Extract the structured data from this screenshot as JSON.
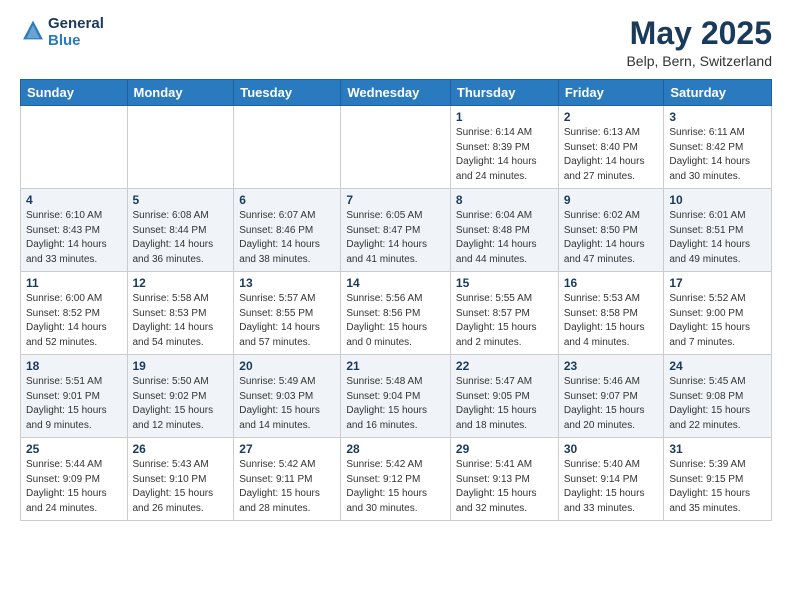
{
  "logo": {
    "line1": "General",
    "line2": "Blue"
  },
  "title": "May 2025",
  "subtitle": "Belp, Bern, Switzerland",
  "weekdays": [
    "Sunday",
    "Monday",
    "Tuesday",
    "Wednesday",
    "Thursday",
    "Friday",
    "Saturday"
  ],
  "weeks": [
    [
      {
        "day": "",
        "info": ""
      },
      {
        "day": "",
        "info": ""
      },
      {
        "day": "",
        "info": ""
      },
      {
        "day": "",
        "info": ""
      },
      {
        "day": "1",
        "info": "Sunrise: 6:14 AM\nSunset: 8:39 PM\nDaylight: 14 hours\nand 24 minutes."
      },
      {
        "day": "2",
        "info": "Sunrise: 6:13 AM\nSunset: 8:40 PM\nDaylight: 14 hours\nand 27 minutes."
      },
      {
        "day": "3",
        "info": "Sunrise: 6:11 AM\nSunset: 8:42 PM\nDaylight: 14 hours\nand 30 minutes."
      }
    ],
    [
      {
        "day": "4",
        "info": "Sunrise: 6:10 AM\nSunset: 8:43 PM\nDaylight: 14 hours\nand 33 minutes."
      },
      {
        "day": "5",
        "info": "Sunrise: 6:08 AM\nSunset: 8:44 PM\nDaylight: 14 hours\nand 36 minutes."
      },
      {
        "day": "6",
        "info": "Sunrise: 6:07 AM\nSunset: 8:46 PM\nDaylight: 14 hours\nand 38 minutes."
      },
      {
        "day": "7",
        "info": "Sunrise: 6:05 AM\nSunset: 8:47 PM\nDaylight: 14 hours\nand 41 minutes."
      },
      {
        "day": "8",
        "info": "Sunrise: 6:04 AM\nSunset: 8:48 PM\nDaylight: 14 hours\nand 44 minutes."
      },
      {
        "day": "9",
        "info": "Sunrise: 6:02 AM\nSunset: 8:50 PM\nDaylight: 14 hours\nand 47 minutes."
      },
      {
        "day": "10",
        "info": "Sunrise: 6:01 AM\nSunset: 8:51 PM\nDaylight: 14 hours\nand 49 minutes."
      }
    ],
    [
      {
        "day": "11",
        "info": "Sunrise: 6:00 AM\nSunset: 8:52 PM\nDaylight: 14 hours\nand 52 minutes."
      },
      {
        "day": "12",
        "info": "Sunrise: 5:58 AM\nSunset: 8:53 PM\nDaylight: 14 hours\nand 54 minutes."
      },
      {
        "day": "13",
        "info": "Sunrise: 5:57 AM\nSunset: 8:55 PM\nDaylight: 14 hours\nand 57 minutes."
      },
      {
        "day": "14",
        "info": "Sunrise: 5:56 AM\nSunset: 8:56 PM\nDaylight: 15 hours\nand 0 minutes."
      },
      {
        "day": "15",
        "info": "Sunrise: 5:55 AM\nSunset: 8:57 PM\nDaylight: 15 hours\nand 2 minutes."
      },
      {
        "day": "16",
        "info": "Sunrise: 5:53 AM\nSunset: 8:58 PM\nDaylight: 15 hours\nand 4 minutes."
      },
      {
        "day": "17",
        "info": "Sunrise: 5:52 AM\nSunset: 9:00 PM\nDaylight: 15 hours\nand 7 minutes."
      }
    ],
    [
      {
        "day": "18",
        "info": "Sunrise: 5:51 AM\nSunset: 9:01 PM\nDaylight: 15 hours\nand 9 minutes."
      },
      {
        "day": "19",
        "info": "Sunrise: 5:50 AM\nSunset: 9:02 PM\nDaylight: 15 hours\nand 12 minutes."
      },
      {
        "day": "20",
        "info": "Sunrise: 5:49 AM\nSunset: 9:03 PM\nDaylight: 15 hours\nand 14 minutes."
      },
      {
        "day": "21",
        "info": "Sunrise: 5:48 AM\nSunset: 9:04 PM\nDaylight: 15 hours\nand 16 minutes."
      },
      {
        "day": "22",
        "info": "Sunrise: 5:47 AM\nSunset: 9:05 PM\nDaylight: 15 hours\nand 18 minutes."
      },
      {
        "day": "23",
        "info": "Sunrise: 5:46 AM\nSunset: 9:07 PM\nDaylight: 15 hours\nand 20 minutes."
      },
      {
        "day": "24",
        "info": "Sunrise: 5:45 AM\nSunset: 9:08 PM\nDaylight: 15 hours\nand 22 minutes."
      }
    ],
    [
      {
        "day": "25",
        "info": "Sunrise: 5:44 AM\nSunset: 9:09 PM\nDaylight: 15 hours\nand 24 minutes."
      },
      {
        "day": "26",
        "info": "Sunrise: 5:43 AM\nSunset: 9:10 PM\nDaylight: 15 hours\nand 26 minutes."
      },
      {
        "day": "27",
        "info": "Sunrise: 5:42 AM\nSunset: 9:11 PM\nDaylight: 15 hours\nand 28 minutes."
      },
      {
        "day": "28",
        "info": "Sunrise: 5:42 AM\nSunset: 9:12 PM\nDaylight: 15 hours\nand 30 minutes."
      },
      {
        "day": "29",
        "info": "Sunrise: 5:41 AM\nSunset: 9:13 PM\nDaylight: 15 hours\nand 32 minutes."
      },
      {
        "day": "30",
        "info": "Sunrise: 5:40 AM\nSunset: 9:14 PM\nDaylight: 15 hours\nand 33 minutes."
      },
      {
        "day": "31",
        "info": "Sunrise: 5:39 AM\nSunset: 9:15 PM\nDaylight: 15 hours\nand 35 minutes."
      }
    ]
  ]
}
